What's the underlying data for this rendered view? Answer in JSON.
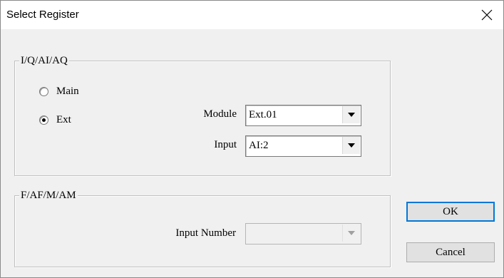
{
  "window": {
    "title": "Select Register"
  },
  "group_ioaiaq": {
    "legend": "I/Q/AI/AQ",
    "radios": [
      {
        "label": "Main",
        "checked": false
      },
      {
        "label": "Ext",
        "checked": true
      }
    ],
    "module": {
      "label": "Module",
      "value": "Ext.01"
    },
    "input": {
      "label": "Input",
      "value": "AI:2"
    }
  },
  "group_fafmam": {
    "legend": "F/AF/M/AM",
    "input_number": {
      "label": "Input Number",
      "value": ""
    }
  },
  "buttons": {
    "ok": "OK",
    "cancel": "Cancel"
  },
  "icons": {
    "close": "close-icon",
    "dropdown": "chevron-down-icon"
  },
  "colors": {
    "dialog_bg": "#f0f0f0",
    "titlebar_bg": "#ffffff",
    "default_button_border": "#0078d7"
  }
}
